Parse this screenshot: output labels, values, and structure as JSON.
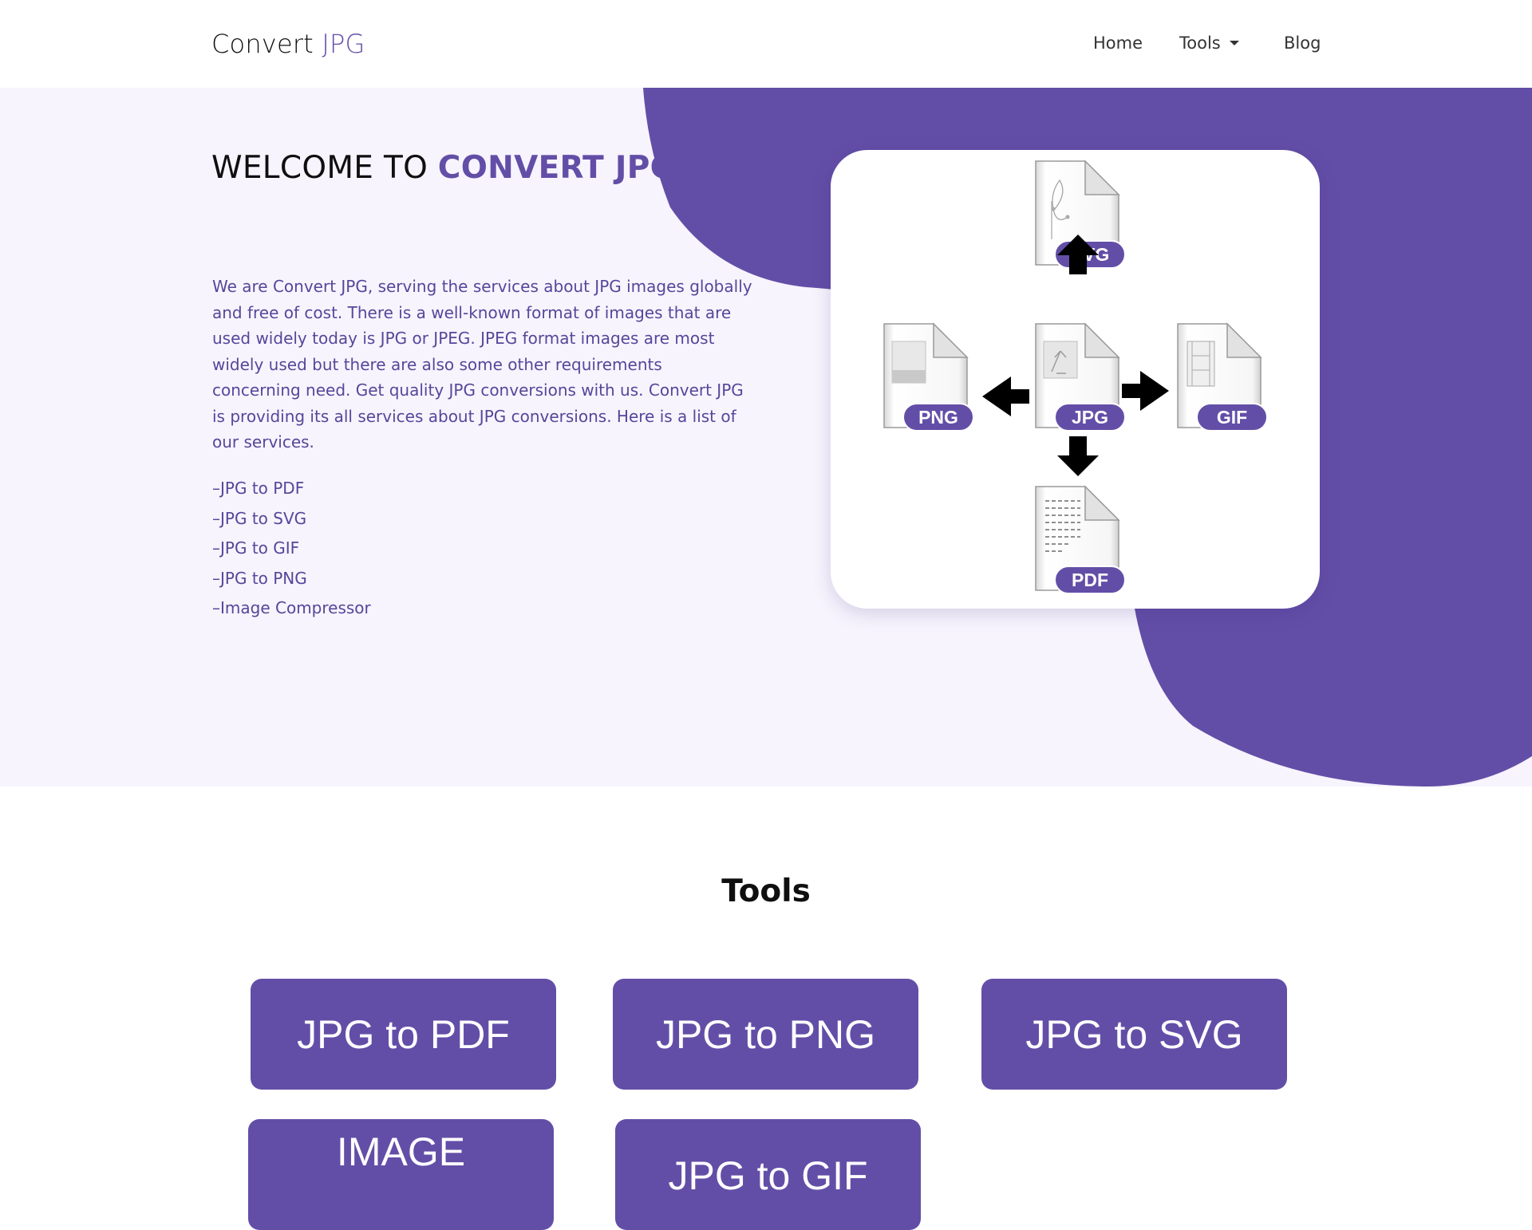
{
  "nav": {
    "brand_main": "Convert",
    "brand_accent": "JPG",
    "links": [
      "Home",
      "Tools",
      "Blog"
    ]
  },
  "hero": {
    "title_prefix": "WELCOME TO",
    "title_accent": "CONVERT JPG",
    "description": "We are Convert JPG, serving the services about JPG images globally and free of cost. There is a well-known format of images that are used widely today is JPG or JPEG. JPEG format images are most widely used but there are also some other requirements concerning need. Get quality JPG conversions with us. Convert JPG is providing its all services about JPG conversions. Here is a list of our services.",
    "services": [
      "–JPG to PDF",
      "–JPG to SVG",
      "–JPG to GIF",
      "–JPG to PNG",
      "–Image Compressor"
    ],
    "diagram_labels": {
      "top": "SVG",
      "left": "PNG",
      "center": "JPG",
      "right": "GIF",
      "bottom": "PDF"
    }
  },
  "tools": {
    "title": "Tools",
    "buttons": [
      "JPG to PDF",
      "JPG to PNG",
      "JPG to SVG",
      "IMAGE",
      "JPG to GIF"
    ]
  },
  "colors": {
    "accent": "#634ea7",
    "hero_bg": "#f7f4fd",
    "text_body": "#55479a"
  }
}
